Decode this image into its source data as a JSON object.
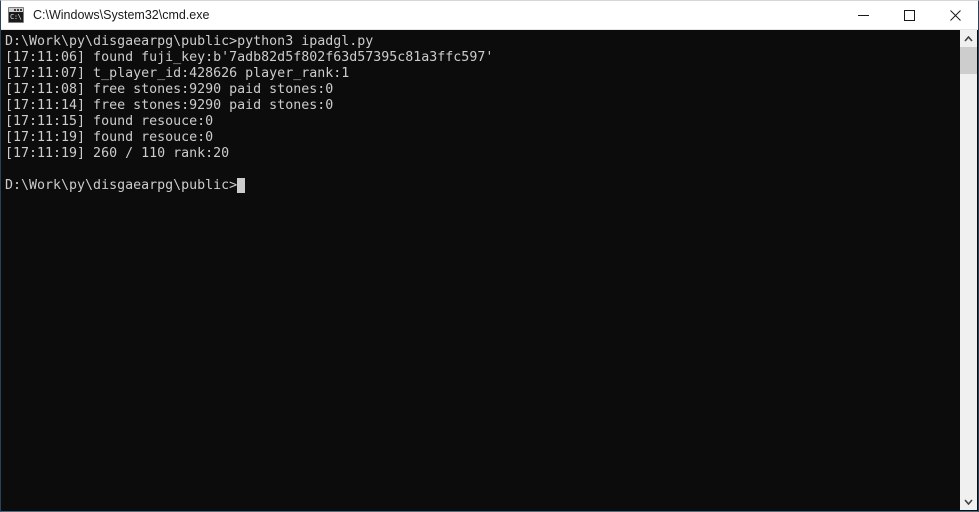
{
  "window": {
    "title": "C:\\Windows\\System32\\cmd.exe",
    "icon": "cmd-icon",
    "icon_text": "C:\\",
    "background_color": "#0c0c0c",
    "text_color": "#cccccc",
    "titlebar_color": "#ffffff",
    "border_color": "#2b4059"
  },
  "window_controls": {
    "minimize_label": "Minimize",
    "maximize_label": "Maximize",
    "close_label": "Close"
  },
  "terminal": {
    "lines": [
      "D:\\Work\\py\\disgaearpg\\public>python3 ipadgl.py",
      "[17:11:06] found fuji_key:b'7adb82d5f802f63d57395c81a3ffc597'",
      "[17:11:07] t_player_id:428626 player_rank:1",
      "[17:11:08] free stones:9290 paid stones:0",
      "[17:11:14] free stones:9290 paid stones:0",
      "[17:11:15] found resouce:0",
      "[17:11:19] found resouce:0",
      "[17:11:19] 260 / 110 rank:20",
      ""
    ],
    "prompt": "D:\\Work\\py\\disgaearpg\\public>",
    "cursor": "block"
  },
  "scrollbar": {
    "up_arrow": "chevron-up-icon",
    "down_arrow": "chevron-down-icon",
    "thumb_position_percent": 0,
    "thumb_size_percent": 6
  }
}
